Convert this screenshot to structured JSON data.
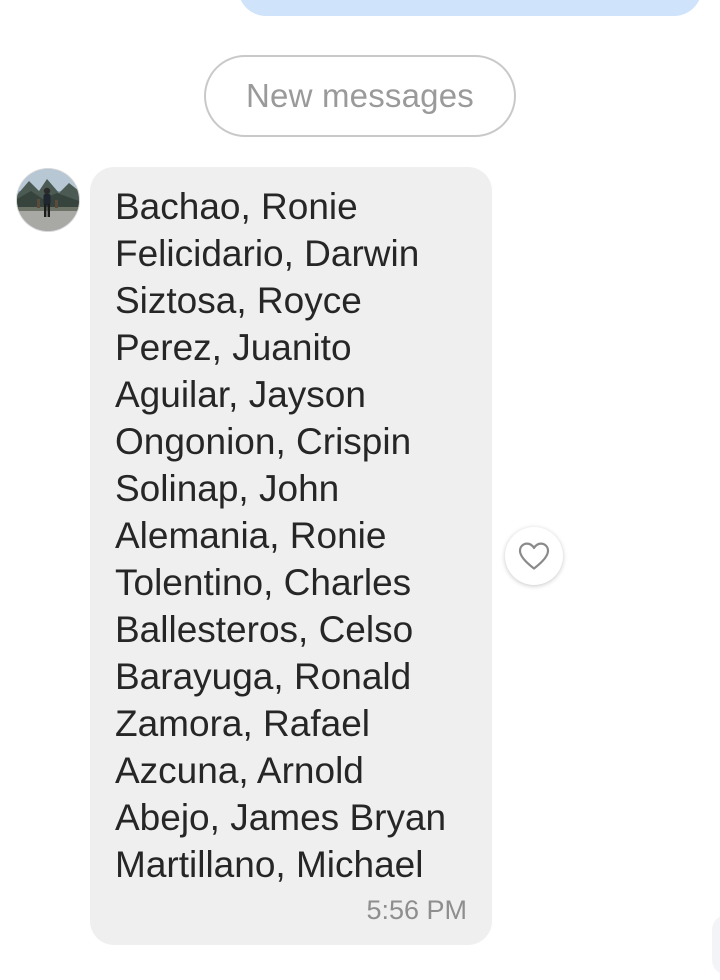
{
  "new_messages_label": "New messages",
  "message": {
    "lines": [
      "Bachao, Ronie",
      "Felicidario, Darwin",
      "Siztosa, Royce",
      "Perez, Juanito",
      "Aguilar, Jayson",
      "Ongonion, Crispin",
      "Solinap, John",
      "Alemania, Ronie",
      "Tolentino, Charles",
      "Ballesteros, Celso",
      "Barayuga, Ronald",
      "Zamora, Rafael",
      "Azcuna, Arnold",
      "Abejo, James Bryan",
      "Martillano, Michael"
    ],
    "timestamp": "5:56 PM"
  },
  "icons": {
    "like": "heart-outline-icon",
    "avatar": "user-avatar"
  },
  "colors": {
    "sent_bubble": "#cfe3fb",
    "received_bubble": "#efefef",
    "text": "#262626",
    "muted_text": "#8e8e8e"
  }
}
